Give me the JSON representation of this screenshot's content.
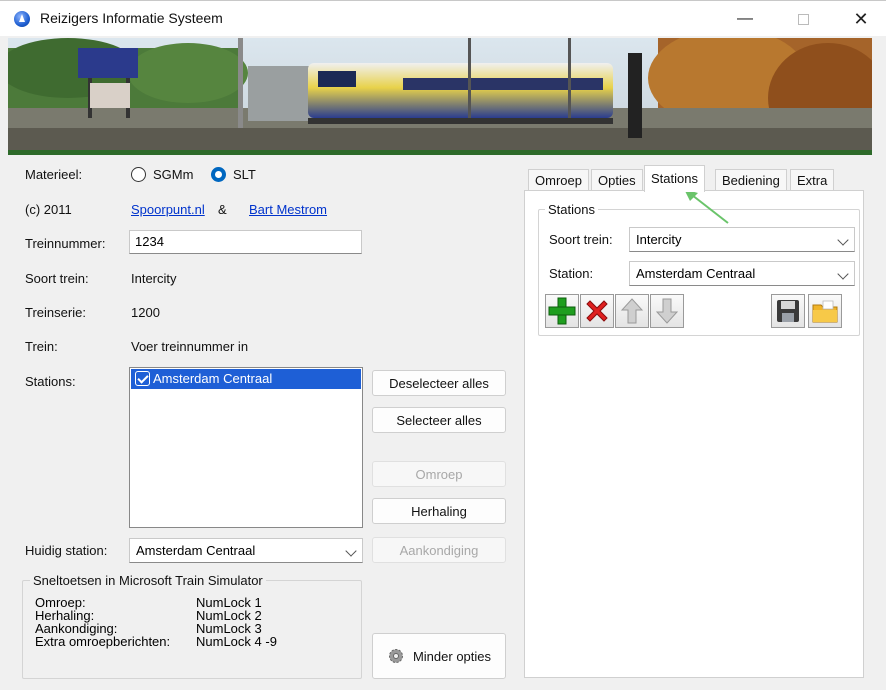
{
  "window": {
    "title": "Reizigers Informatie Systeem",
    "minimize_glyph": "—",
    "close_glyph": "✕"
  },
  "materieel": {
    "label": "Materieel:",
    "options": [
      "SGMm",
      "SLT"
    ],
    "selected": "SLT"
  },
  "credits": {
    "copyright": "(c) 2011",
    "link1": "Spoorpunt.nl",
    "amp": "&",
    "link2": "Bart Mestrom"
  },
  "fields": {
    "treinnummer": {
      "label": "Treinnummer:",
      "value": "1234"
    },
    "soort_trein": {
      "label": "Soort trein:",
      "value": "Intercity"
    },
    "treinserie": {
      "label": "Treinserie:",
      "value": "1200"
    },
    "trein": {
      "label": "Trein:",
      "value": "Voer treinnummer in"
    },
    "stations": {
      "label": "Stations:",
      "items": [
        {
          "name": "Amsterdam Centraal",
          "checked": true,
          "selected": true
        }
      ]
    },
    "huidig_station": {
      "label": "Huidig station:",
      "value": "Amsterdam Centraal"
    }
  },
  "buttons": {
    "deselect_all": "Deselecteer alles",
    "select_all": "Selecteer alles",
    "omroep": "Omroep",
    "herhaling": "Herhaling",
    "aankondiging": "Aankondiging",
    "minder_opties": "Minder opties"
  },
  "shortcuts": {
    "title": "Sneltoetsen in Microsoft Train Simulator",
    "rows": [
      {
        "name": "Omroep:",
        "key": "NumLock 1"
      },
      {
        "name": "Herhaling:",
        "key": "NumLock 2"
      },
      {
        "name": "Aankondiging:",
        "key": "NumLock 3"
      },
      {
        "name": "Extra omroepberichten:",
        "key": "NumLock 4 -9"
      }
    ]
  },
  "tabs": {
    "items": [
      "Omroep",
      "Opties",
      "Stations",
      "Bediening",
      "Extra"
    ],
    "active": "Stations"
  },
  "stations_tab": {
    "group_title": "Stations",
    "soort_trein_label": "Soort trein:",
    "soort_trein_value": "Intercity",
    "station_label": "Station:",
    "station_value": "Amsterdam Centraal",
    "toolbar_icons": [
      "add-icon",
      "delete-icon",
      "arrow-up-icon",
      "arrow-down-icon",
      "save-icon",
      "open-folder-icon"
    ]
  },
  "colors": {
    "accent": "#0067c0",
    "selection": "#1e5fd6",
    "link": "#0033cc",
    "annotation_arrow": "#6ac46a"
  }
}
